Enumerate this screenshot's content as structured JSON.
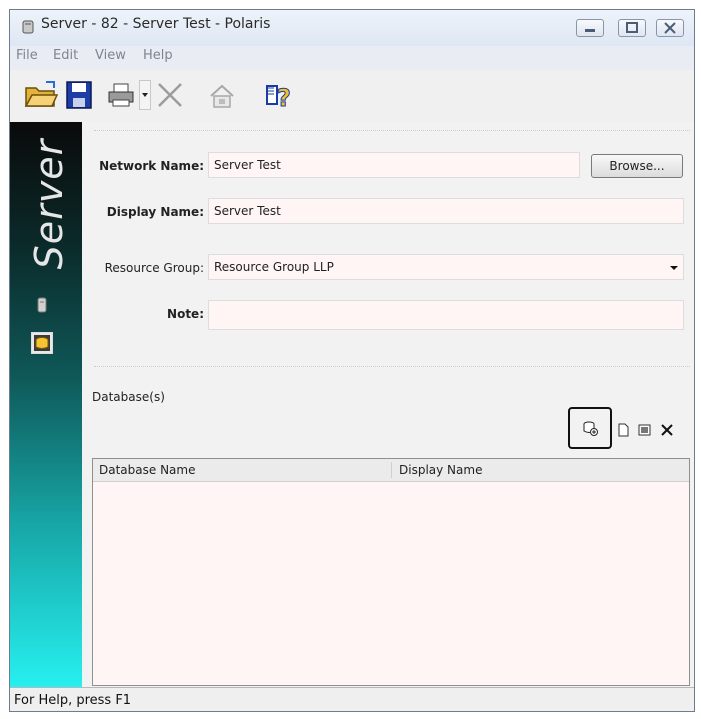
{
  "window": {
    "title": "Server - 82 - Server Test - Polaris"
  },
  "menu": {
    "file": "File",
    "edit": "Edit",
    "view": "View",
    "help": "Help"
  },
  "sidebar": {
    "title": "Server"
  },
  "form": {
    "network_name_label": "Network Name:",
    "network_name_value": "Server Test",
    "browse_label": "Browse...",
    "display_name_label": "Display Name:",
    "display_name_value": "Server Test",
    "resource_group_label": "Resource Group:",
    "resource_group_value": "Resource Group LLP",
    "note_label": "Note:",
    "note_value": ""
  },
  "databases": {
    "section_label": "Database(s)",
    "columns": [
      "Database Name",
      "Display Name"
    ],
    "rows": []
  },
  "status": {
    "text": "For Help, press F1"
  },
  "colors": {
    "field_bg": "#fff5f5",
    "sidebar_top": "#0a0a0a",
    "sidebar_bottom": "#27f0f0",
    "highlight_border": "#111111"
  },
  "icons": [
    "open-folder-icon",
    "save-icon",
    "print-icon",
    "dropdown-arrow-icon",
    "delete-icon",
    "properties-icon",
    "help-icon",
    "server-icon",
    "database-icon",
    "add-database-icon",
    "new-icon",
    "edit-icon",
    "remove-icon"
  ]
}
